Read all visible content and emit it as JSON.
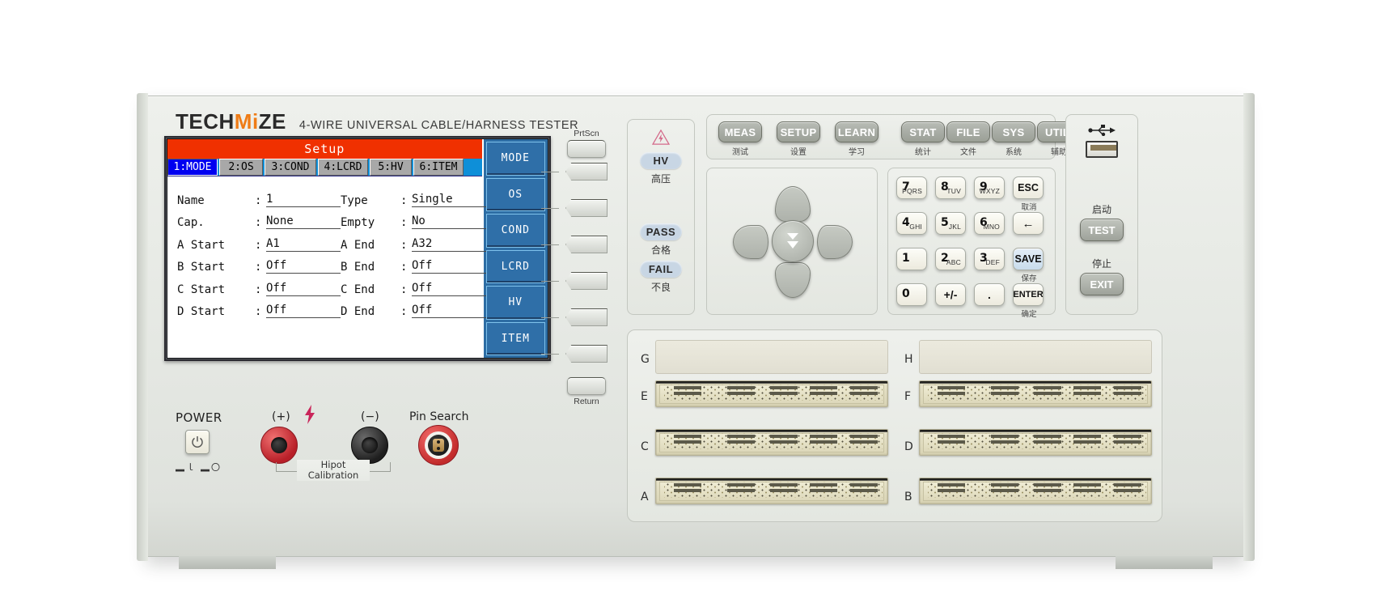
{
  "brand": {
    "logo_part1": "TECH",
    "logo_part2": "Mi",
    "logo_part3": "ZE",
    "model_line": "4-WIRE  UNIVERSAL  CABLE/HARNESS  TESTER"
  },
  "screen": {
    "title": "Setup",
    "tabs": [
      {
        "label": "1:MODE",
        "active": true
      },
      {
        "label": "2:OS",
        "active": false
      },
      {
        "label": "3:COND",
        "active": false
      },
      {
        "label": "4:LCRD",
        "active": false
      },
      {
        "label": "5:HV",
        "active": false
      },
      {
        "label": "6:ITEM",
        "active": false
      }
    ],
    "fields": [
      {
        "label": "Name",
        "colon": ":",
        "value": "1",
        "label2": "Type",
        "colon2": ":",
        "value2": "Single"
      },
      {
        "label": "Cap.",
        "colon": ":",
        "value": "None",
        "label2": "Empty",
        "colon2": ":",
        "value2": "No"
      },
      {
        "label": "A Start",
        "colon": ":",
        "value": "A1",
        "label2": "A End",
        "colon2": ":",
        "value2": "A32"
      },
      {
        "label": "B Start",
        "colon": ":",
        "value": "Off",
        "label2": "B End",
        "colon2": ":",
        "value2": "Off"
      },
      {
        "label": "C Start",
        "colon": ":",
        "value": "Off",
        "label2": "C End",
        "colon2": ":",
        "value2": "Off"
      },
      {
        "label": "D Start",
        "colon": ":",
        "value": "Off",
        "label2": "D End",
        "colon2": ":",
        "value2": "Off"
      }
    ],
    "softkeys": [
      "MODE",
      "OS",
      "COND",
      "LCRD",
      "HV",
      "ITEM"
    ],
    "colors": {
      "title_bar": "#f03000",
      "tab_bar": "#0e8fd8",
      "tab_active": "#0000f0",
      "softkey": "#2f6fa8"
    }
  },
  "softkey_column": {
    "top_label": "PrtScn",
    "bottom_label": "Return"
  },
  "status_panel": {
    "hv": {
      "label": "HV",
      "sub": "高压"
    },
    "pass": {
      "label": "PASS",
      "sub": "合格"
    },
    "fail": {
      "label": "FAIL",
      "sub": "不良"
    },
    "warning_icon": "high-voltage-warning-icon"
  },
  "function_keys": [
    {
      "label": "MEAS",
      "sub": "测试"
    },
    {
      "label": "SETUP",
      "sub": "设置"
    },
    {
      "label": "LEARN",
      "sub": "学习"
    },
    {
      "label": "STAT",
      "sub": "统计"
    },
    {
      "label": "FILE",
      "sub": "文件"
    },
    {
      "label": "SYS",
      "sub": "系统"
    },
    {
      "label": "UTILI",
      "sub": "辅助"
    }
  ],
  "arrow_pad": {
    "up": "arrow-up-icon",
    "down": "arrow-down-icon",
    "left": "arrow-left-icon",
    "right": "arrow-right-icon",
    "center": "double-arrow-down-icon"
  },
  "keypad": {
    "keys": [
      {
        "num": "7",
        "alpha": "PQRS"
      },
      {
        "num": "8",
        "alpha": "TUV"
      },
      {
        "num": "9",
        "alpha": "WXYZ"
      },
      {
        "num": "4",
        "alpha": "GHI"
      },
      {
        "num": "5",
        "alpha": "JKL"
      },
      {
        "num": "6",
        "alpha": "MNO"
      },
      {
        "num": "1",
        "alpha": ""
      },
      {
        "num": "2",
        "alpha": "ABC"
      },
      {
        "num": "3",
        "alpha": "DEF"
      },
      {
        "num": "0",
        "alpha": ""
      },
      {
        "num": "+/-",
        "alpha": ""
      },
      {
        "num": ".",
        "alpha": ""
      }
    ],
    "side": [
      {
        "label": "ESC",
        "sub": "取消"
      },
      {
        "label": "←",
        "sub": ""
      },
      {
        "label": "SAVE",
        "sub": "保存"
      },
      {
        "label": "ENTER",
        "sub": "确定"
      }
    ],
    "save_color": "#cfe0ef"
  },
  "io_panel": {
    "usb_icon": "usb-icon",
    "test": {
      "label": "TEST",
      "sub": "启动"
    },
    "exit": {
      "label": "EXIT",
      "sub": "停止"
    }
  },
  "connectors": {
    "rows": [
      {
        "left": "G",
        "right": "H",
        "type": "blank"
      },
      {
        "left": "E",
        "right": "F",
        "type": "connector"
      },
      {
        "left": "C",
        "right": "D",
        "type": "connector"
      },
      {
        "left": "A",
        "right": "B",
        "type": "connector"
      }
    ]
  },
  "bottom_controls": {
    "power_label": "POWER",
    "power_icon": "power-icon",
    "power_marks": "▂ｌ ▂〇",
    "plus_label": "(+)",
    "minus_label": "(−)",
    "hv_bolt_icon": "lightning-bolt-icon",
    "pin_search_label": "Pin Search",
    "hipot_line1": "Hipot",
    "hipot_line2": "Calibration"
  }
}
